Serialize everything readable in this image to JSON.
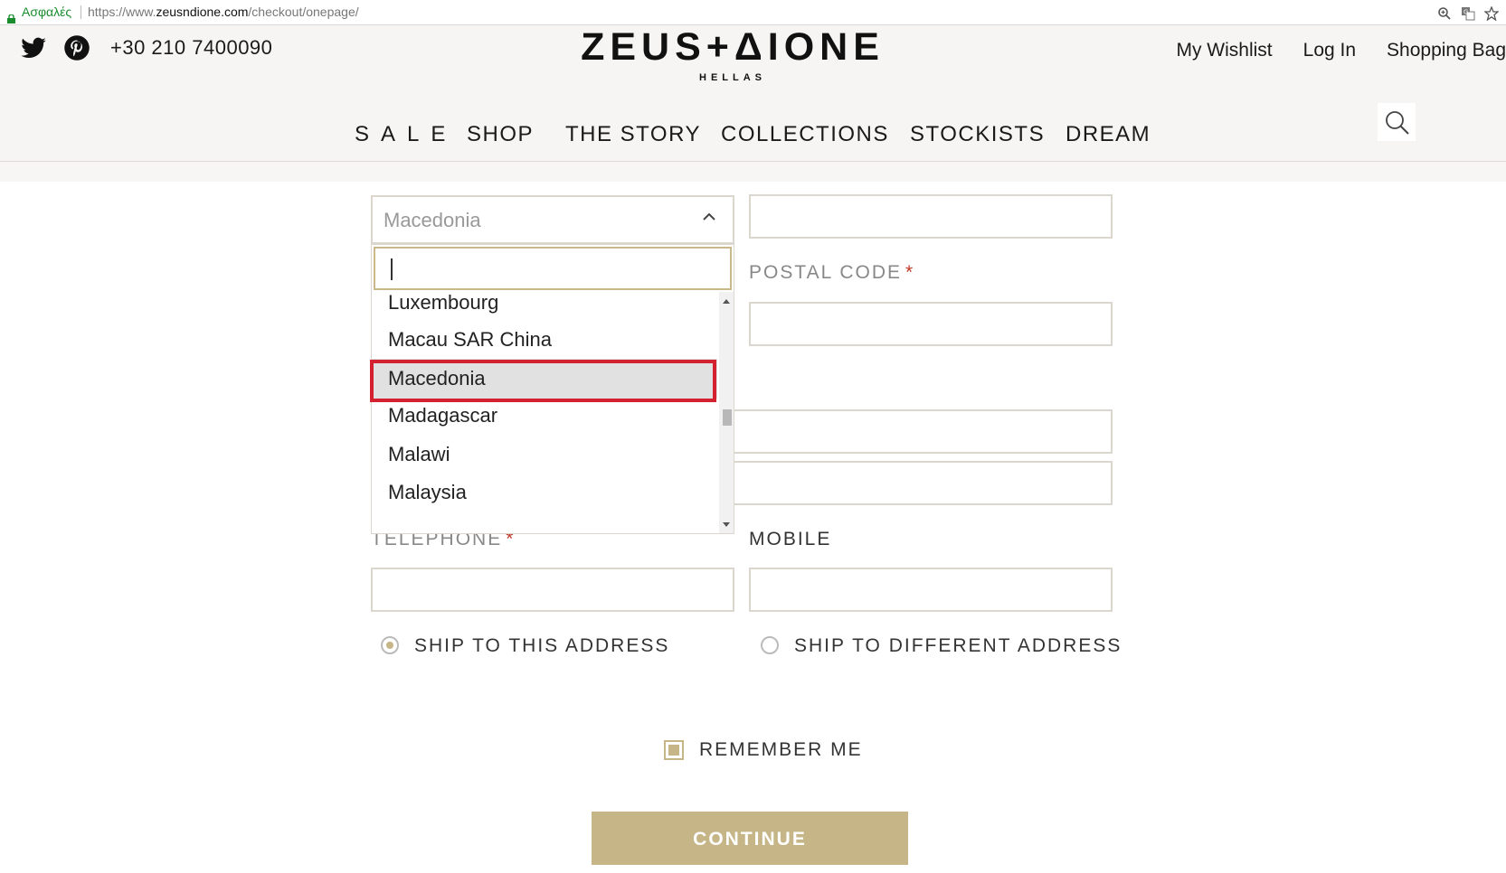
{
  "browser": {
    "secure_label": "Ασφαλές",
    "url_prefix": "https://www.",
    "url_host": "zeusndione.com",
    "url_path": "/checkout/onepage/"
  },
  "header": {
    "phone": "+30 210 7400090",
    "logo_main": "ZEUS+ΔIONE",
    "logo_sub": "HELLAS",
    "links": [
      "My Wishlist",
      "Log In",
      "Shopping Bag"
    ],
    "nav": [
      "SALE",
      "SHOP",
      "THE STORY",
      "COLLECTIONS",
      "STOCKISTS",
      "DREAM"
    ]
  },
  "form": {
    "country_select": {
      "value": "Macedonia"
    },
    "dropdown": {
      "search_value": "",
      "options": [
        "Luxembourg",
        "Macau SAR China",
        "Macedonia",
        "Madagascar",
        "Malawi",
        "Malaysia"
      ],
      "selected": "Macedonia"
    },
    "postal_code_label": "POSTAL CODE",
    "telephone_label": "TELEPHONE",
    "mobile_label": "MOBILE",
    "required_mark": "*",
    "ship_options": [
      {
        "label": "SHIP TO THIS ADDRESS",
        "checked": true
      },
      {
        "label": "SHIP TO DIFFERENT ADDRESS",
        "checked": false
      }
    ],
    "remember_me": {
      "label": "REMEMBER ME",
      "checked": true
    },
    "continue_label": "CONTINUE"
  },
  "colors": {
    "accent_gold": "#c5b587",
    "highlight_red": "#d3212f",
    "secure_green": "#1a8c2e"
  }
}
